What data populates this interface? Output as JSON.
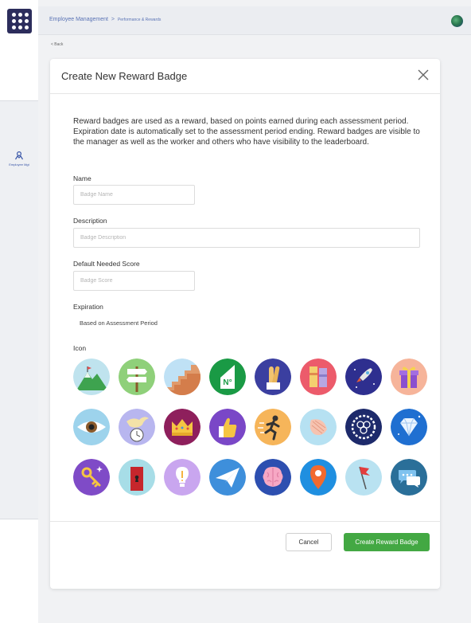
{
  "app": {
    "logo_icon": "app-grid-icon"
  },
  "sidebar": {
    "items": [
      {
        "label": "Employee Mgt",
        "icon": "employee-icon"
      }
    ]
  },
  "header": {
    "breadcrumb_root": "Employee Management",
    "breadcrumb_sep": ">",
    "breadcrumb_current": "Performance & Rewards",
    "avatar_icon": "globe-icon"
  },
  "back_link": "< Back",
  "modal": {
    "title": "Create New Reward Badge",
    "intro": "Reward badges are used as a reward, based on points earned during each assessment period. Expiration date is automatically set to the assessment period ending. Reward badges are visible to the manager as well as the worker and others who have visibility to the leaderboard.",
    "fields": {
      "name_label": "Name",
      "name_placeholder": "Badge Name",
      "name_value": "",
      "description_label": "Description",
      "description_placeholder": "Badge Description",
      "description_value": "",
      "score_label": "Default Needed Score",
      "score_placeholder": "Badge Score",
      "score_value": "",
      "expiration_label": "Expiration",
      "expiration_value": "Based on Assessment Period",
      "icon_label": "Icon"
    },
    "icons": [
      "mountain-peak-icon",
      "signpost-icon",
      "stairs-icon",
      "number-sign-icon",
      "fingers-crossed-icon",
      "books-icon",
      "rocket-icon",
      "gift-icon",
      "eye-icon",
      "dove-clock-icon",
      "crown-icon",
      "thumbs-up-icon",
      "runner-icon",
      "sea-shell-icon",
      "gear-circles-icon",
      "diamond-icon",
      "magic-key-icon",
      "locked-door-icon",
      "lightbulb-icon",
      "paper-plane-icon",
      "brain-icon",
      "map-pin-icon",
      "flag-icon",
      "chat-bubbles-icon"
    ],
    "cancel_label": "Cancel",
    "create_label": "Create Reward Badge"
  },
  "colors": {
    "primary_blue": "#3a57a8",
    "create_button": "#43a843",
    "logo_background": "#2c2d5c"
  }
}
